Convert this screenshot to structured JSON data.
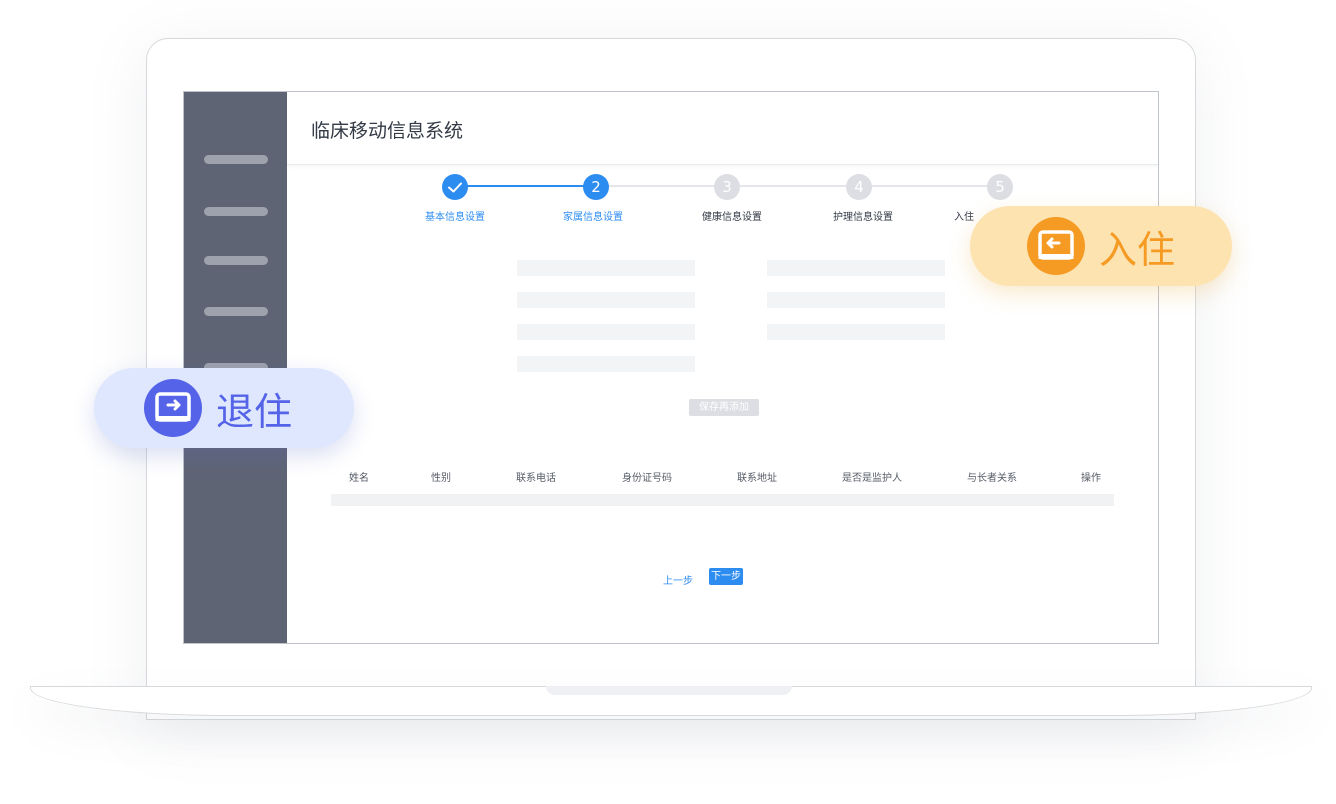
{
  "header": {
    "app_title": "临床移动信息系统"
  },
  "steps": [
    {
      "number": "",
      "label": "基本信息设置",
      "state": "done"
    },
    {
      "number": "2",
      "label": "家属信息设置",
      "state": "active"
    },
    {
      "number": "3",
      "label": "健康信息设置",
      "state": "pending"
    },
    {
      "number": "4",
      "label": "护理信息设置",
      "state": "pending"
    },
    {
      "number": "5",
      "label": "入住",
      "state": "pending"
    }
  ],
  "form": {
    "save_add_label": "保存再添加"
  },
  "table": {
    "columns": [
      "姓名",
      "性别",
      "联系电话",
      "身份证号码",
      "联系地址",
      "是否是监护人",
      "与长者关系",
      "操作"
    ]
  },
  "nav": {
    "prev_label": "上一步",
    "next_label": "下一步"
  },
  "badges": {
    "checkin_label": "入住",
    "checkout_label": "退住"
  },
  "colors": {
    "accent": "#2d8cf0",
    "pending": "#dcdee3",
    "checkin": "#f59a23",
    "checkout": "#5463e8",
    "sidebar": "#5f6475"
  }
}
